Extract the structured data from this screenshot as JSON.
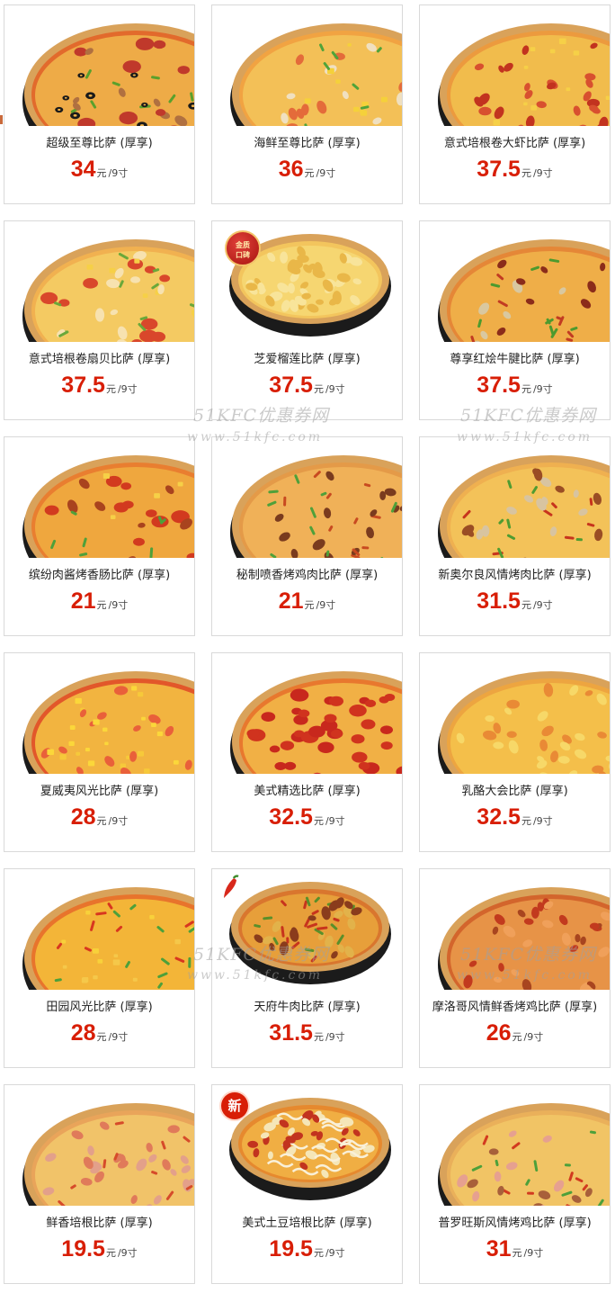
{
  "menu": {
    "items": [
      {
        "name": "超级至尊比萨 (厚享)",
        "price": "34",
        "unit": "元",
        "size": "/9寸",
        "topping": "supreme",
        "badge": ""
      },
      {
        "name": "海鲜至尊比萨 (厚享)",
        "price": "36",
        "unit": "元",
        "size": "/9寸",
        "topping": "seafood",
        "badge": ""
      },
      {
        "name": "意式培根卷大虾比萨 (厚享)",
        "price": "37.5",
        "unit": "元",
        "size": "/9寸",
        "topping": "shrimp",
        "badge": ""
      },
      {
        "name": "意式培根卷扇贝比萨 (厚享)",
        "price": "37.5",
        "unit": "元",
        "size": "/9寸",
        "topping": "scallop",
        "badge": ""
      },
      {
        "name": "芝爱榴莲比萨 (厚享)",
        "price": "37.5",
        "unit": "元",
        "size": "/9寸",
        "topping": "durian",
        "badge": "gold"
      },
      {
        "name": "尊享红烩牛腱比萨 (厚享)",
        "price": "37.5",
        "unit": "元",
        "size": "/9寸",
        "topping": "beef",
        "badge": ""
      },
      {
        "name": "缤纷肉酱烤香肠比萨 (厚享)",
        "price": "21",
        "unit": "元",
        "size": "/9寸",
        "topping": "sausage",
        "badge": ""
      },
      {
        "name": "秘制喷香烤鸡肉比萨 (厚享)",
        "price": "21",
        "unit": "元",
        "size": "/9寸",
        "topping": "chicken",
        "badge": ""
      },
      {
        "name": "新奥尔良风情烤肉比萨 (厚享)",
        "price": "31.5",
        "unit": "元",
        "size": "/9寸",
        "topping": "orleans",
        "badge": ""
      },
      {
        "name": "夏威夷风光比萨 (厚享)",
        "price": "28",
        "unit": "元",
        "size": "/9寸",
        "topping": "hawaii",
        "badge": ""
      },
      {
        "name": "美式精选比萨 (厚享)",
        "price": "32.5",
        "unit": "元",
        "size": "/9寸",
        "topping": "pepperoni",
        "badge": ""
      },
      {
        "name": "乳酪大会比萨 (厚享)",
        "price": "32.5",
        "unit": "元",
        "size": "/9寸",
        "topping": "cheese",
        "badge": ""
      },
      {
        "name": "田园风光比萨 (厚享)",
        "price": "28",
        "unit": "元",
        "size": "/9寸",
        "topping": "veggie",
        "badge": ""
      },
      {
        "name": "天府牛肉比萨 (厚享)",
        "price": "31.5",
        "unit": "元",
        "size": "/9寸",
        "topping": "tianfu",
        "badge": "chili"
      },
      {
        "name": "摩洛哥风情鲜香烤鸡比萨 (厚享)",
        "price": "26",
        "unit": "元",
        "size": "/9寸",
        "topping": "morocco",
        "badge": ""
      },
      {
        "name": "鲜香培根比萨 (厚享)",
        "price": "19.5",
        "unit": "元",
        "size": "/9寸",
        "topping": "bacon",
        "badge": ""
      },
      {
        "name": "美式土豆培根比萨 (厚享)",
        "price": "19.5",
        "unit": "元",
        "size": "/9寸",
        "topping": "potato",
        "badge": "new"
      },
      {
        "name": "普罗旺斯风情烤鸡比萨 (厚享)",
        "price": "31",
        "unit": "元",
        "size": "/9寸",
        "topping": "provence",
        "badge": ""
      }
    ]
  },
  "badges": {
    "gold_text": "金质\n口碑",
    "new_text": "新"
  },
  "watermark": {
    "title": "51KFC优惠券网",
    "url": "www.51kfc.com"
  },
  "colors": {
    "price": "#d81e06",
    "border": "#d9d9d9",
    "crust": "#d9a25a",
    "pan": "#1b1b1b"
  }
}
